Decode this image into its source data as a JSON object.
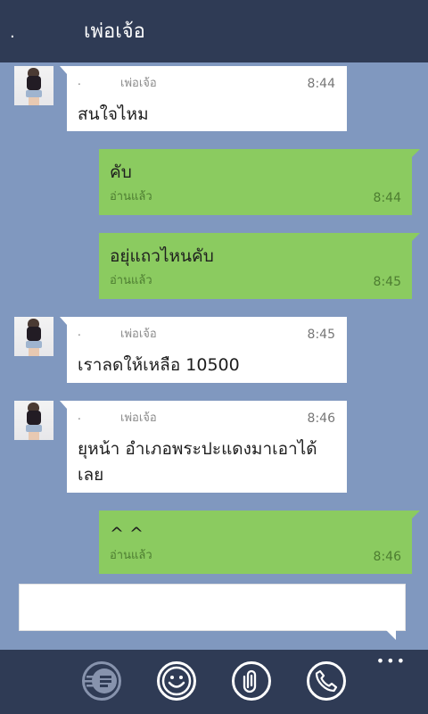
{
  "header": {
    "dot": ".",
    "title": "เพ่อเจ้อ"
  },
  "messages": [
    {
      "direction": "in",
      "dot": ".",
      "sender": "เพ่อเจ้อ",
      "time": "8:44",
      "text": "สนใจไหม"
    },
    {
      "direction": "out",
      "text": "คับ",
      "status": "อ่านแล้ว",
      "time": "8:44"
    },
    {
      "direction": "out",
      "text": "อยุ่แถวไหนคับ",
      "status": "อ่านแล้ว",
      "time": "8:45"
    },
    {
      "direction": "in",
      "dot": ".",
      "sender": "เพ่อเจ้อ",
      "time": "8:45",
      "text": "เราลดให้เหลือ 10500"
    },
    {
      "direction": "in",
      "dot": ".",
      "sender": "เพ่อเจ้อ",
      "time": "8:46",
      "text": "ยุหน้า อำเภอพระปะแดงมาเอาได้เลย"
    },
    {
      "direction": "out",
      "text": "^ ^",
      "status": "อ่านแล้ว",
      "time": "8:46"
    }
  ],
  "composer": {
    "placeholder": ""
  },
  "appbar": {
    "icons": [
      "quick-reply-icon",
      "emoji-icon",
      "attach-icon",
      "phone-icon"
    ],
    "more": "•••"
  },
  "colors": {
    "background": "#8098bf",
    "header": "#2f3b55",
    "incoming": "#ffffff",
    "outgoing": "#8bcb60"
  }
}
